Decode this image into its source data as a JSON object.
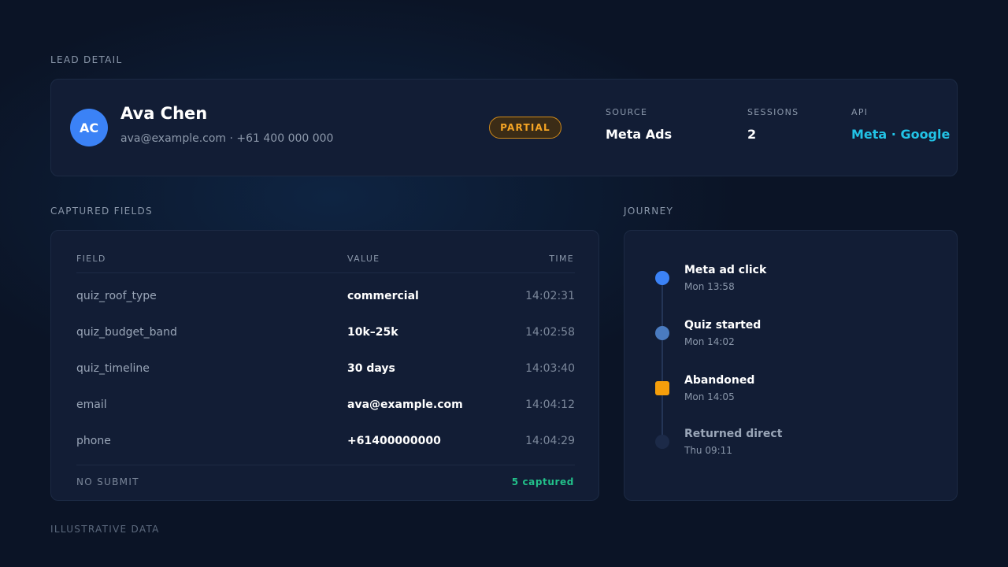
{
  "page": {
    "section_title": "LEAD DETAIL",
    "footer_note": "ILLUSTRATIVE DATA"
  },
  "lead": {
    "initials": "AC",
    "name": "Ava Chen",
    "contact": "ava@example.com · +61 400 000 000",
    "status": "PARTIAL",
    "meta": [
      {
        "label": "SOURCE",
        "value": "Meta Ads"
      },
      {
        "label": "SESSIONS",
        "value": "2"
      },
      {
        "label": "API",
        "value": "Meta · Google"
      }
    ]
  },
  "captured": {
    "section_title": "CAPTURED FIELDS",
    "columns": {
      "field": "FIELD",
      "value": "VALUE",
      "time": "TIME"
    },
    "rows": [
      {
        "field": "quiz_roof_type",
        "value": "commercial",
        "time": "14:02:31"
      },
      {
        "field": "quiz_budget_band",
        "value": "10k–25k",
        "time": "14:02:58"
      },
      {
        "field": "quiz_timeline",
        "value": "30 days",
        "time": "14:03:40"
      },
      {
        "field": "email",
        "value": "ava@example.com",
        "time": "14:04:12"
      },
      {
        "field": "phone",
        "value": "+61400000000",
        "time": "14:04:29"
      }
    ],
    "footer_status": "NO SUBMIT",
    "footer_count": "5 captured"
  },
  "journey": {
    "section_title": "JOURNEY",
    "events": [
      {
        "title": "Meta ad click",
        "time": "Mon 13:58"
      },
      {
        "title": "Quiz started",
        "time": "Mon 14:02"
      },
      {
        "title": "Abandoned",
        "time": "Mon 14:05"
      },
      {
        "title": "Returned direct",
        "time": "Thu 09:11"
      }
    ]
  },
  "colors": {
    "background": "#0b1426",
    "card": "#121d35",
    "accent_blue": "#3b82f6",
    "accent_cyan": "#22c3e6",
    "warning_amber": "#f5a524",
    "success_green": "#22c08a"
  }
}
